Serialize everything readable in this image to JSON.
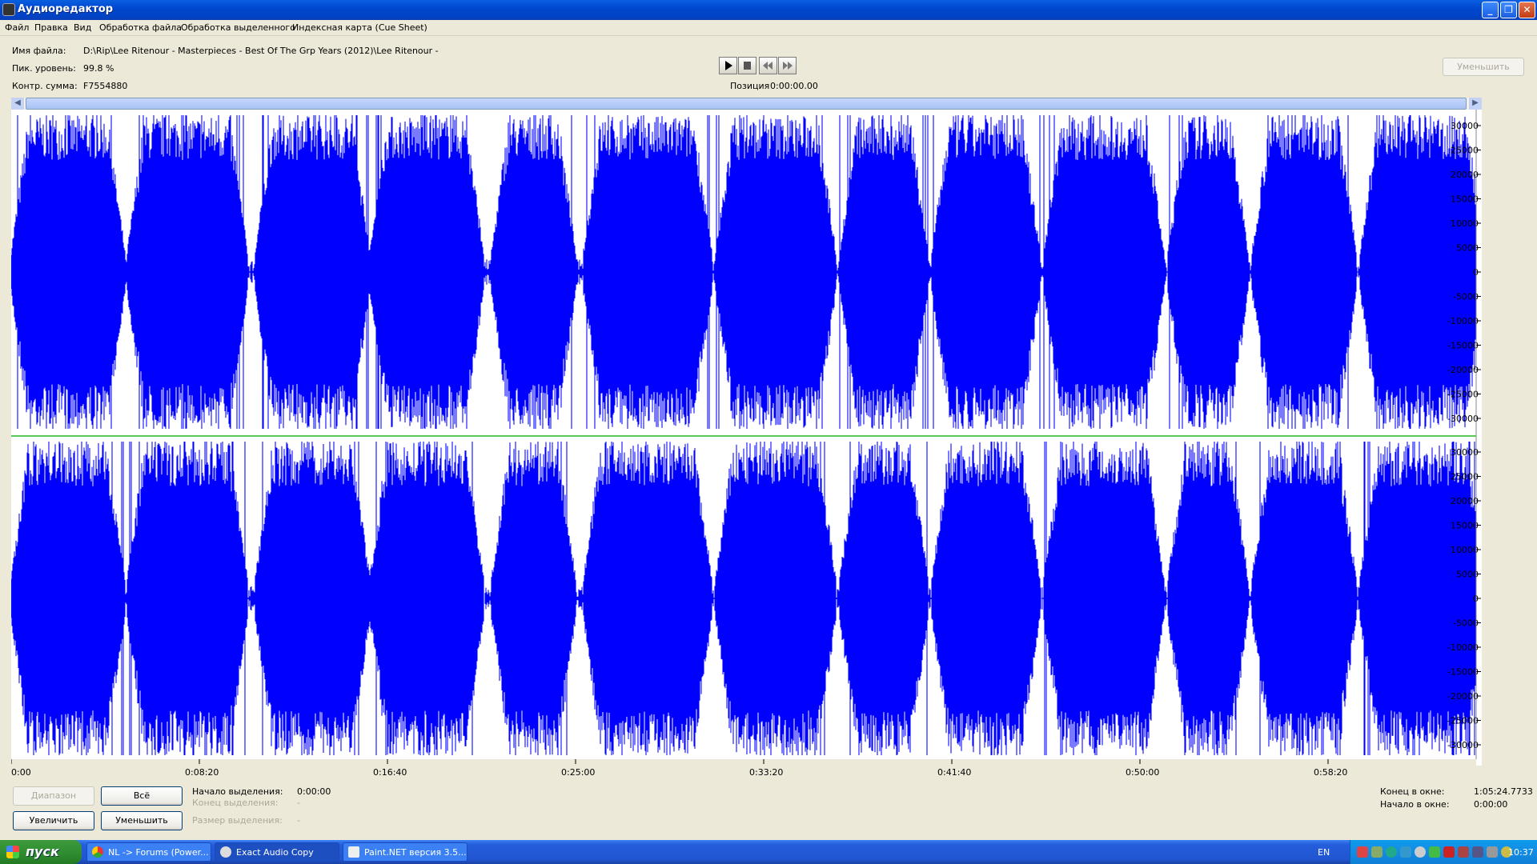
{
  "window": {
    "title": "Аудиоредактор",
    "controls": [
      "_",
      "❐",
      "✕"
    ]
  },
  "menu": [
    "Файл",
    "Правка",
    "Вид",
    "Обработка файла",
    "Обработка выделенного",
    "Индексная карта (Cue Sheet)"
  ],
  "info": {
    "filename_label": "Имя файла:",
    "filename_value": "D:\\Rip\\Lee Ritenour - Masterpieces - Best Of The Grp Years (2012)\\Lee Ritenour -",
    "peak_label": "Пик. уровень:",
    "peak_value": "99.8 %",
    "checksum_label": "Контр. сумма:",
    "checksum_value": "F7554880"
  },
  "transport": {
    "position_label": "Позиция",
    "position_value": "0:00:00.00",
    "icons": [
      "play-icon",
      "stop-icon",
      "rewind-icon",
      "fast-forward-icon"
    ]
  },
  "zoom_out_top_label": "Уменьшить",
  "waveform": {
    "color": "#0000FF",
    "separator_color": "#58C858",
    "axis_labels": [
      "30000",
      "25000",
      "20000",
      "15000",
      "10000",
      "5000",
      "0",
      "-5000",
      "-10000",
      "-15000",
      "-20000",
      "-25000",
      "-30000"
    ],
    "time_labels": [
      "0:00",
      "0:08:20",
      "0:16:40",
      "0:25:00",
      "0:33:20",
      "0:41:40",
      "0:50:00",
      "0:58:20"
    ]
  },
  "bottom": {
    "range_btn": "Диапазон",
    "all_btn": "Всё",
    "zoom_in_btn": "Увеличить",
    "zoom_out_btn": "Уменьшить",
    "sel_start_label": "Начало выделения:",
    "sel_start_value": "0:00:00",
    "sel_end_label": "Конец выделения:",
    "sel_end_value": "-",
    "sel_size_label": "Размер выделения:",
    "sel_size_value": "-",
    "win_end_label": "Конец в окне:",
    "win_end_value": "1:05:24.7733",
    "win_start_label": "Начало в окне:",
    "win_start_value": "0:00:00"
  },
  "taskbar": {
    "start_label": "пуск",
    "tasks": [
      "NL -> Forums (Power...",
      "Exact Audio Copy",
      "Paint.NET версия 3.5..."
    ],
    "lang": "EN",
    "clock": "10:37"
  }
}
